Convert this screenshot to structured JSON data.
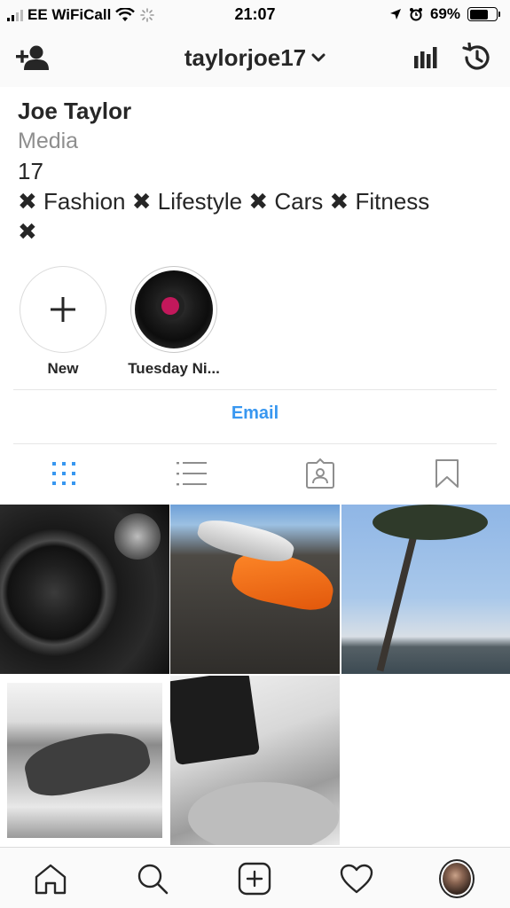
{
  "status_bar": {
    "carrier": "EE WiFiCall",
    "time": "21:07",
    "battery_percent": "69%",
    "battery_level": 0.69,
    "icons": [
      "signal-icon",
      "wifi-icon",
      "activity-spinner-icon",
      "location-arrow-icon",
      "alarm-clock-icon",
      "battery-icon"
    ]
  },
  "nav": {
    "username": "taylorjoe17",
    "icons": [
      "add-person-icon",
      "chevron-down-icon",
      "insights-bars-icon",
      "archive-history-icon"
    ]
  },
  "bio": {
    "name": "Joe Taylor",
    "category": "Media",
    "age": "17",
    "tags_line": "✖ Fashion ✖ Lifestyle ✖ Cars ✖ Fitness",
    "tags_tail": "✖"
  },
  "highlights": [
    {
      "label": "New",
      "icon": "plus-icon"
    },
    {
      "label": "Tuesday Ni..."
    }
  ],
  "contact": {
    "email_label": "Email"
  },
  "tabs": {
    "items": [
      "grid-icon",
      "list-icon",
      "tagged-icon",
      "saved-bookmark-icon"
    ],
    "active": "grid-icon",
    "active_color": "#3897f0"
  },
  "bottom_bar": {
    "items": [
      "home-icon",
      "search-icon",
      "new-post-icon",
      "activity-heart-icon",
      "profile-avatar"
    ]
  },
  "colors": {
    "accent": "#3897f0",
    "text": "#262626",
    "muted": "#8e8e8e",
    "bar_background": "#fafafa"
  }
}
